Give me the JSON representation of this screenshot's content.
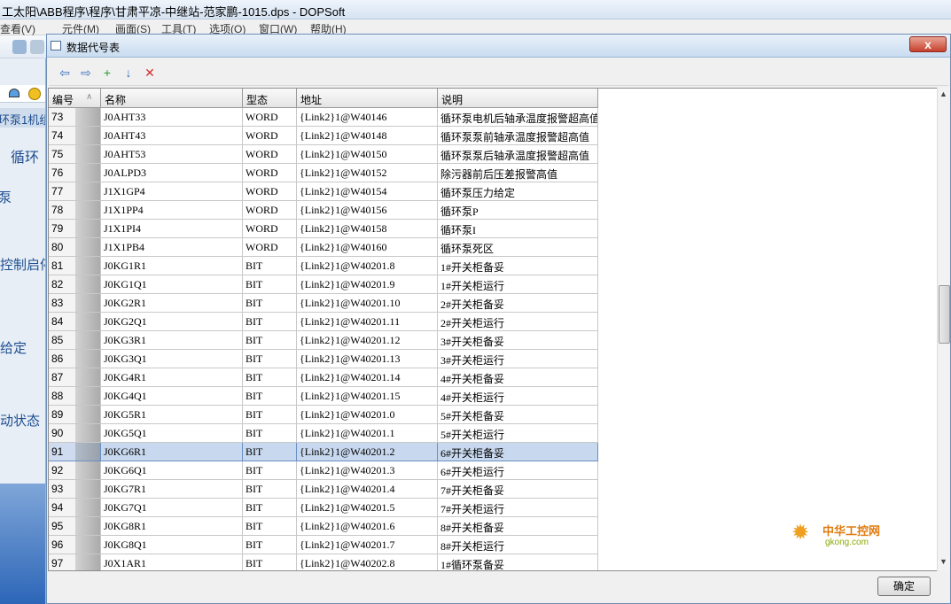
{
  "app": {
    "title": "工太阳\\ABB程序\\程序\\甘肃平凉-中继站-范家鹏-1015.dps - DOPSoft",
    "menu": [
      "查看(V)",
      "元件(M)",
      "画面(S)",
      "工具(T)",
      "选项(O)",
      "窗口(W)",
      "帮助(H)"
    ]
  },
  "background": {
    "labels": [
      "环泵1机组",
      "循环",
      "泵",
      "控制启停",
      "给定",
      "动状态"
    ]
  },
  "dialog": {
    "title": "数据代号表",
    "close_label": "x",
    "ok_label": "确定",
    "toolbar": [
      {
        "name": "import-icon",
        "glyph": "⇦",
        "color": "#3a6fc0"
      },
      {
        "name": "export-icon",
        "glyph": "⇨",
        "color": "#3a6fc0"
      },
      {
        "name": "add-icon",
        "glyph": "+",
        "color": "#2e9a2e"
      },
      {
        "name": "down-icon",
        "glyph": "↓",
        "color": "#3a6fc0"
      },
      {
        "name": "delete-icon",
        "glyph": "✕",
        "color": "#d03030"
      }
    ],
    "columns": [
      "编号",
      "名称",
      "型态",
      "地址",
      "说明"
    ],
    "sort_indicator": "∧",
    "rows": [
      {
        "id": "73",
        "name": "J0AHT33",
        "type": "WORD",
        "addr": "{Link2}1@W40146",
        "desc": "循环泵电机后轴承温度报警超高值"
      },
      {
        "id": "74",
        "name": "J0AHT43",
        "type": "WORD",
        "addr": "{Link2}1@W40148",
        "desc": "循环泵泵前轴承温度报警超高值"
      },
      {
        "id": "75",
        "name": "J0AHT53",
        "type": "WORD",
        "addr": "{Link2}1@W40150",
        "desc": "循环泵泵后轴承温度报警超高值"
      },
      {
        "id": "76",
        "name": "J0ALPD3",
        "type": "WORD",
        "addr": "{Link2}1@W40152",
        "desc": "除污器前后压差报警高值"
      },
      {
        "id": "77",
        "name": "J1X1GP4",
        "type": "WORD",
        "addr": "{Link2}1@W40154",
        "desc": "循环泵压力给定"
      },
      {
        "id": "78",
        "name": "J1X1PP4",
        "type": "WORD",
        "addr": "{Link2}1@W40156",
        "desc": "循环泵P"
      },
      {
        "id": "79",
        "name": "J1X1PI4",
        "type": "WORD",
        "addr": "{Link2}1@W40158",
        "desc": "循环泵I"
      },
      {
        "id": "80",
        "name": "J1X1PB4",
        "type": "WORD",
        "addr": "{Link2}1@W40160",
        "desc": "循环泵死区"
      },
      {
        "id": "81",
        "name": "J0KG1R1",
        "type": "BIT",
        "addr": "{Link2}1@W40201.8",
        "desc": "1#开关柜备妥"
      },
      {
        "id": "82",
        "name": "J0KG1Q1",
        "type": "BIT",
        "addr": "{Link2}1@W40201.9",
        "desc": "1#开关柜运行"
      },
      {
        "id": "83",
        "name": "J0KG2R1",
        "type": "BIT",
        "addr": "{Link2}1@W40201.10",
        "desc": "2#开关柜备妥"
      },
      {
        "id": "84",
        "name": "J0KG2Q1",
        "type": "BIT",
        "addr": "{Link2}1@W40201.11",
        "desc": "2#开关柜运行"
      },
      {
        "id": "85",
        "name": "J0KG3R1",
        "type": "BIT",
        "addr": "{Link2}1@W40201.12",
        "desc": "3#开关柜备妥"
      },
      {
        "id": "86",
        "name": "J0KG3Q1",
        "type": "BIT",
        "addr": "{Link2}1@W40201.13",
        "desc": "3#开关柜运行"
      },
      {
        "id": "87",
        "name": "J0KG4R1",
        "type": "BIT",
        "addr": "{Link2}1@W40201.14",
        "desc": "4#开关柜备妥"
      },
      {
        "id": "88",
        "name": "J0KG4Q1",
        "type": "BIT",
        "addr": "{Link2}1@W40201.15",
        "desc": "4#开关柜运行"
      },
      {
        "id": "89",
        "name": "J0KG5R1",
        "type": "BIT",
        "addr": "{Link2}1@W40201.0",
        "desc": "5#开关柜备妥"
      },
      {
        "id": "90",
        "name": "J0KG5Q1",
        "type": "BIT",
        "addr": "{Link2}1@W40201.1",
        "desc": "5#开关柜运行"
      },
      {
        "id": "91",
        "name": "J0KG6R1",
        "type": "BIT",
        "addr": "{Link2}1@W40201.2",
        "desc": "6#开关柜备妥"
      },
      {
        "id": "92",
        "name": "J0KG6Q1",
        "type": "BIT",
        "addr": "{Link2}1@W40201.3",
        "desc": "6#开关柜运行"
      },
      {
        "id": "93",
        "name": "J0KG7R1",
        "type": "BIT",
        "addr": "{Link2}1@W40201.4",
        "desc": "7#开关柜备妥"
      },
      {
        "id": "94",
        "name": "J0KG7Q1",
        "type": "BIT",
        "addr": "{Link2}1@W40201.5",
        "desc": "7#开关柜运行"
      },
      {
        "id": "95",
        "name": "J0KG8R1",
        "type": "BIT",
        "addr": "{Link2}1@W40201.6",
        "desc": "8#开关柜备妥"
      },
      {
        "id": "96",
        "name": "J0KG8Q1",
        "type": "BIT",
        "addr": "{Link2}1@W40201.7",
        "desc": "8#开关柜运行"
      },
      {
        "id": "97",
        "name": "J0X1AR1",
        "type": "BIT",
        "addr": "{Link2}1@W40202.8",
        "desc": "1#循环泵备妥"
      }
    ],
    "selected_id": "91"
  },
  "watermark": {
    "main": "中华工控网",
    "sub": "gkong.com"
  }
}
